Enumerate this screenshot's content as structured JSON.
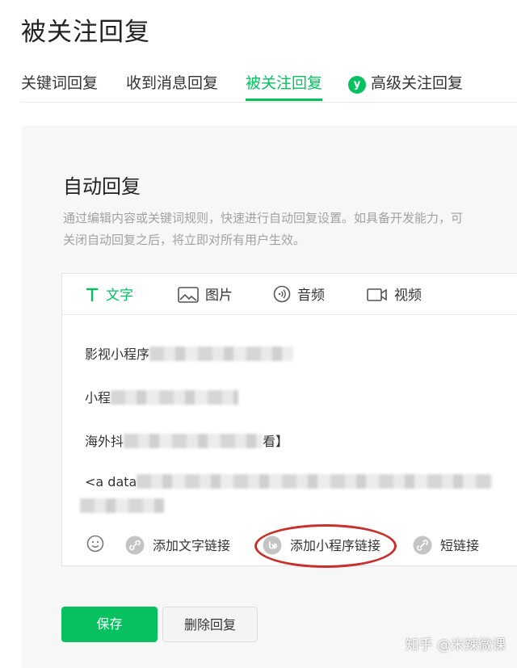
{
  "page": {
    "title": "被关注回复"
  },
  "tabs": [
    {
      "label": "关键词回复",
      "active": false
    },
    {
      "label": "收到消息回复",
      "active": false
    },
    {
      "label": "被关注回复",
      "active": true
    },
    {
      "label": "高级关注回复",
      "active": false,
      "icon": "premium-y-icon"
    }
  ],
  "section": {
    "title": "自动回复",
    "desc_line1": "通过编辑内容或关键词规则，快速进行自动回复设置。如具备开发能力，可",
    "desc_line2": "关闭自动回复之后，将立即对所有用户生效。"
  },
  "editor": {
    "type_tabs": [
      {
        "label": "文字",
        "icon": "text-icon",
        "active": true
      },
      {
        "label": "图片",
        "icon": "image-icon",
        "active": false
      },
      {
        "label": "音频",
        "icon": "audio-icon",
        "active": false
      },
      {
        "label": "视频",
        "icon": "video-icon",
        "active": false
      }
    ],
    "content_lines": [
      "影视小程序",
      "小程",
      "海外抖",
      "<a data"
    ],
    "line3_suffix": "看】",
    "toolbar": {
      "emoji_icon": "emoji-icon",
      "add_text_link": "添加文字链接",
      "add_miniprogram_link": "添加小程序链接",
      "short_link": "短链接"
    }
  },
  "actions": {
    "save": "保存",
    "delete": "删除回复"
  },
  "watermark": "知乎 @米辣微课",
  "colors": {
    "accent": "#07c160",
    "highlight": "#c8302b"
  }
}
